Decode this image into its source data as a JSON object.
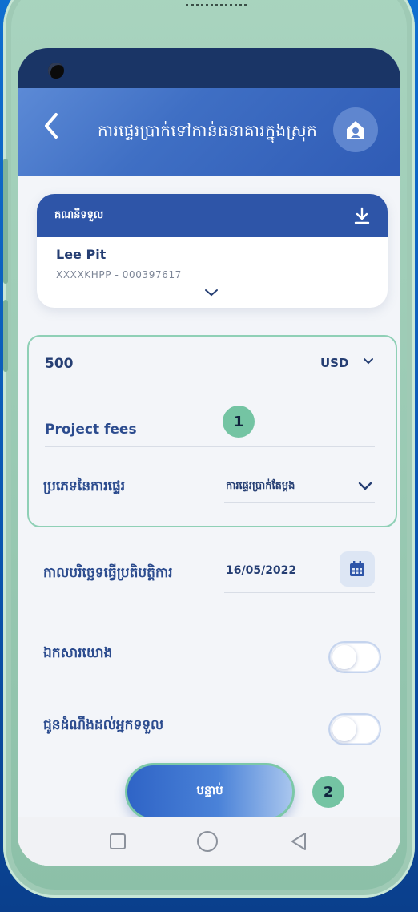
{
  "header": {
    "title": "ការផ្ទេរប្រាក់ទៅកាន់ធនាគារក្នុងស្រុក"
  },
  "account": {
    "section_label": "គណនីទទួល",
    "name": "Lee Pit",
    "number": "XXXXKHPP - 000397617"
  },
  "transfer": {
    "amount": "500",
    "currency": "USD",
    "description": "Project fees",
    "type_label": "ប្រភេទនៃការផ្ទេរ",
    "type_value": "ការផ្ទេរប្រាក់តែម្តង"
  },
  "schedule": {
    "date_label": "កាលបរិច្ឆេទធ្វើប្រតិបត្តិការ",
    "date_value": "16/05/2022"
  },
  "options": {
    "reference_label": "ឯកសារយោង",
    "reference_enabled": false,
    "notify_label": "ជូនដំណឹងដល់អ្នកទទួល",
    "notify_enabled": false
  },
  "actions": {
    "next_label": "បន្ទាប់"
  },
  "annotations": {
    "badge_1": "1",
    "badge_2": "2"
  },
  "icons": [
    "back-icon",
    "home-icon",
    "download-icon",
    "chevron-down-icon",
    "calendar-icon",
    "nav-recents-icon",
    "nav-home-icon",
    "nav-back-icon"
  ],
  "colors": {
    "primary": "#2e55a8",
    "accent": "#74c4a3",
    "text": "#253e73"
  }
}
